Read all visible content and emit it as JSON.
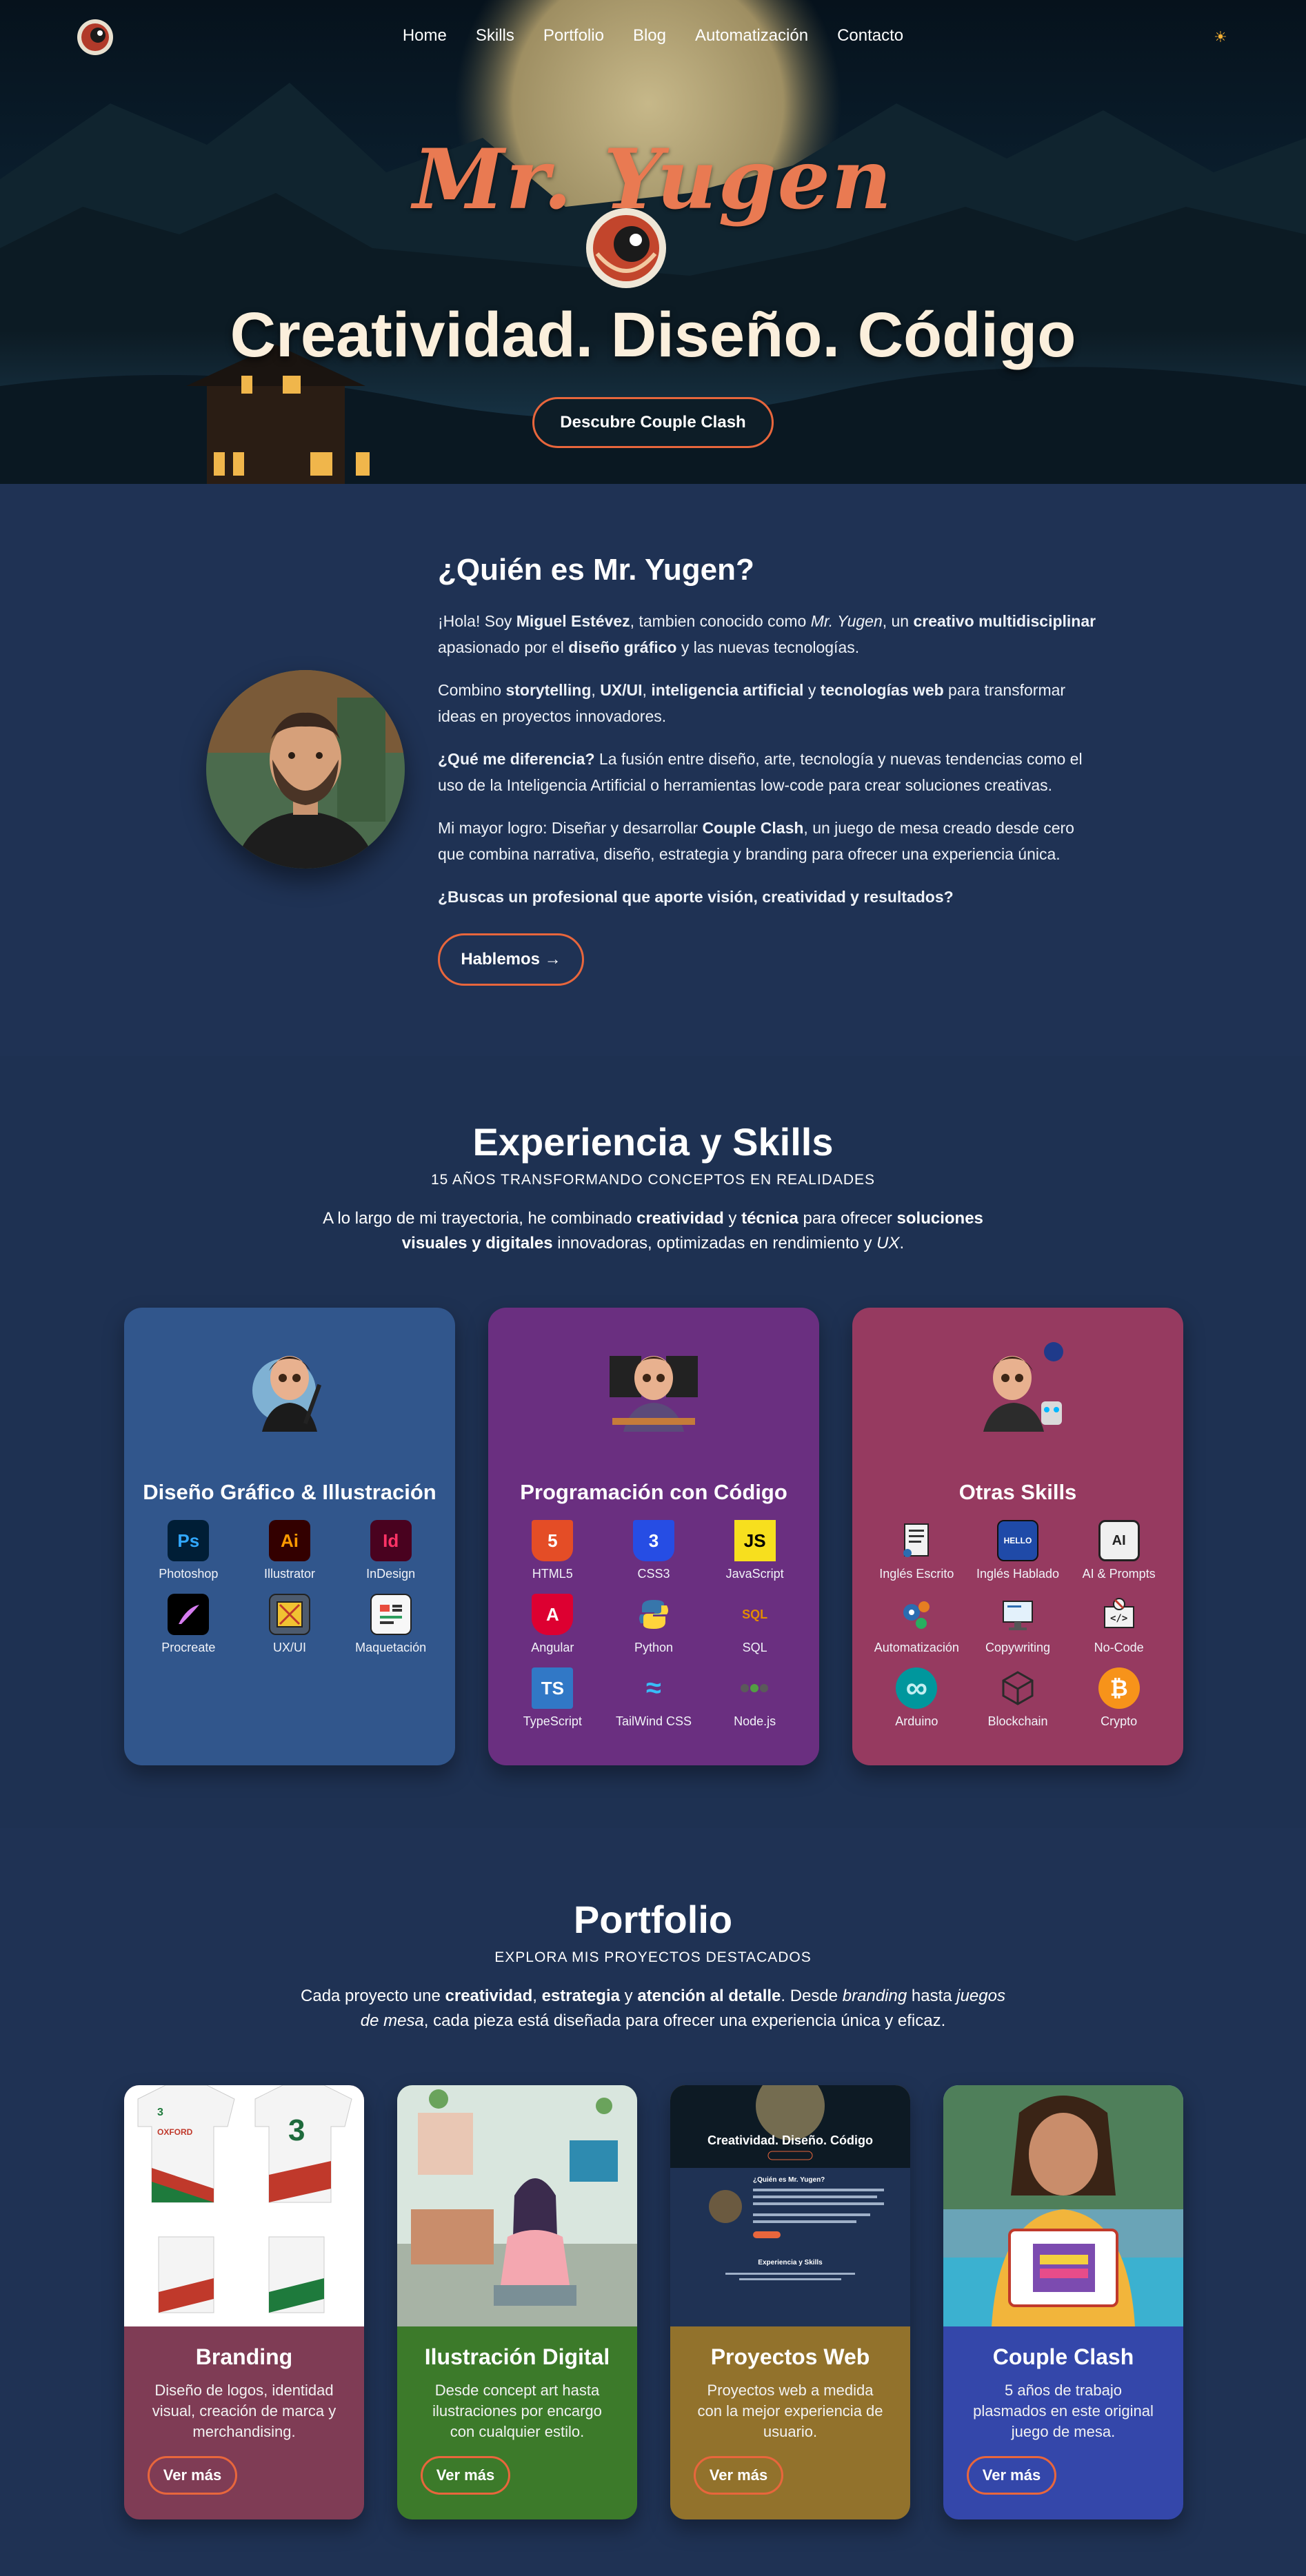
{
  "nav": {
    "logo_icon": "yugen-logo-icon",
    "items": [
      "Home",
      "Skills",
      "Portfolio",
      "Blog",
      "Automatización",
      "Contacto"
    ],
    "theme_icon": "sun-icon"
  },
  "hero": {
    "brand": "Mr. Yugen",
    "title": "Creatividad. Diseño. Código",
    "cta": "Descubre Couple Clash"
  },
  "about": {
    "title": "¿Quién es Mr. Yugen?",
    "p1": {
      "a": "¡Hola! Soy ",
      "b": "Miguel Estévez",
      "c": ", tambien conocido como ",
      "d": "Mr. Yugen",
      "e": ", un ",
      "f": "creativo multidisciplinar",
      "g": " apasionado por el ",
      "h": "diseño gráfico",
      "i": " y las nuevas tecnologías."
    },
    "p2": {
      "a": "Combino ",
      "b": "storytelling",
      "c": ", ",
      "d": "UX/UI",
      "e": ", ",
      "f": "inteligencia artificial",
      "g": " y ",
      "h": "tecnologías web",
      "i": " para transformar ideas en proyectos innovadores."
    },
    "p3": {
      "a": "¿Qué me diferencia?",
      "b": " La fusión entre diseño, arte, tecnología y nuevas tendencias como el uso de la Inteligencia Artificial o herramientas low-code para crear soluciones creativas."
    },
    "p4": {
      "a": "Mi mayor logro: Diseñar y desarrollar ",
      "b": "Couple Clash",
      "c": ", un juego de mesa creado desde cero que combina narrativa, diseño, estrategia y branding para ofrecer una experiencia única."
    },
    "p5": "¿Buscas un profesional que aporte visión, creatividad y resultados?",
    "cta": "Hablemos →"
  },
  "skills": {
    "title": "Experiencia y Skills",
    "subtitle": "15 AÑOS TRANSFORMANDO CONCEPTOS EN REALIDADES",
    "desc": {
      "a": "A lo largo de mi trayectoria, he combinado ",
      "b": "creatividad",
      "c": " y ",
      "d": "técnica",
      "e": " para ofrecer ",
      "f": "soluciones visuales y digitales",
      "g": " innovadoras, optimizadas en rendimiento y ",
      "h": "UX",
      "i": "."
    },
    "cards": [
      {
        "title": "Diseño Gráfico & Illustración",
        "color": "#31568c",
        "items": [
          {
            "label": "Photoshop",
            "icon": "photoshop-icon",
            "glyph": "Ps"
          },
          {
            "label": "Illustrator",
            "icon": "illustrator-icon",
            "glyph": "Ai"
          },
          {
            "label": "InDesign",
            "icon": "indesign-icon",
            "glyph": "Id"
          },
          {
            "label": "Procreate",
            "icon": "procreate-icon",
            "glyph": ""
          },
          {
            "label": "UX/UI",
            "icon": "ux-ui-icon",
            "glyph": ""
          },
          {
            "label": "Maquetación",
            "icon": "layout-icon",
            "glyph": ""
          }
        ]
      },
      {
        "title": "Programación con Código",
        "color": "#6a2f80",
        "items": [
          {
            "label": "HTML5",
            "icon": "html5-icon",
            "glyph": "5"
          },
          {
            "label": "CSS3",
            "icon": "css3-icon",
            "glyph": "3"
          },
          {
            "label": "JavaScript",
            "icon": "javascript-icon",
            "glyph": "JS"
          },
          {
            "label": "Angular",
            "icon": "angular-icon",
            "glyph": "A"
          },
          {
            "label": "Python",
            "icon": "python-icon",
            "glyph": ""
          },
          {
            "label": "SQL",
            "icon": "sql-icon",
            "glyph": "SQL"
          },
          {
            "label": "TypeScript",
            "icon": "typescript-icon",
            "glyph": "TS"
          },
          {
            "label": "TailWind CSS",
            "icon": "tailwind-icon",
            "glyph": "≈"
          },
          {
            "label": "Node.js",
            "icon": "nodejs-icon",
            "glyph": ""
          }
        ]
      },
      {
        "title": "Otras Skills",
        "color": "#963a60",
        "items": [
          {
            "label": "Inglés Escrito",
            "icon": "written-english-icon",
            "glyph": ""
          },
          {
            "label": "Inglés Hablado",
            "icon": "spoken-english-icon",
            "glyph": "HELLO"
          },
          {
            "label": "AI & Prompts",
            "icon": "ai-chip-icon",
            "glyph": "AI"
          },
          {
            "label": "Automatización",
            "icon": "automation-icon",
            "glyph": ""
          },
          {
            "label": "Copywriting",
            "icon": "copywriting-icon",
            "glyph": ""
          },
          {
            "label": "No-Code",
            "icon": "no-code-icon",
            "glyph": ""
          },
          {
            "label": "Arduino",
            "icon": "arduino-icon",
            "glyph": "∞"
          },
          {
            "label": "Blockchain",
            "icon": "blockchain-icon",
            "glyph": ""
          },
          {
            "label": "Crypto",
            "icon": "bitcoin-icon",
            "glyph": "₿"
          }
        ]
      }
    ]
  },
  "portfolio": {
    "title": "Portfolio",
    "subtitle": "EXPLORA MIS PROYECTOS DESTACADOS",
    "desc": {
      "a": "Cada proyecto une ",
      "b": "creatividad",
      "c": ", ",
      "d": "estrategia",
      "e": " y ",
      "f": "atención al detalle",
      "g": ". Desde ",
      "h": "branding",
      "i": " hasta ",
      "j": "juegos de mesa",
      "k": ", cada pieza está diseñada para ofrecer una experiencia única y eficaz."
    },
    "cards": [
      {
        "title": "Branding",
        "desc": "Diseño de logos, identidad visual, creación de marca y merchandising.",
        "button": "Ver más",
        "color": "#7f3c55"
      },
      {
        "title": "Ilustración Digital",
        "desc": "Desde concept art hasta ilustraciones por encargo con cualquier estilo.",
        "button": "Ver más",
        "color": "#3c7a2a"
      },
      {
        "title": "Proyectos Web",
        "desc": "Proyectos web a medida con la mejor experiencia de usuario.",
        "button": "Ver más",
        "color": "#92722c"
      },
      {
        "title": "Couple Clash",
        "desc": "5 años de trabajo plasmados en este original juego de mesa.",
        "button": "Ver más",
        "color": "#3447aa"
      }
    ],
    "jersey_brand": "OXFORD",
    "jersey_number": "3",
    "web_preview_title": "Creatividad. Diseño. Código",
    "web_preview_about": "¿Quién es Mr. Yugen?",
    "web_preview_skills": "Experiencia y Skills"
  }
}
